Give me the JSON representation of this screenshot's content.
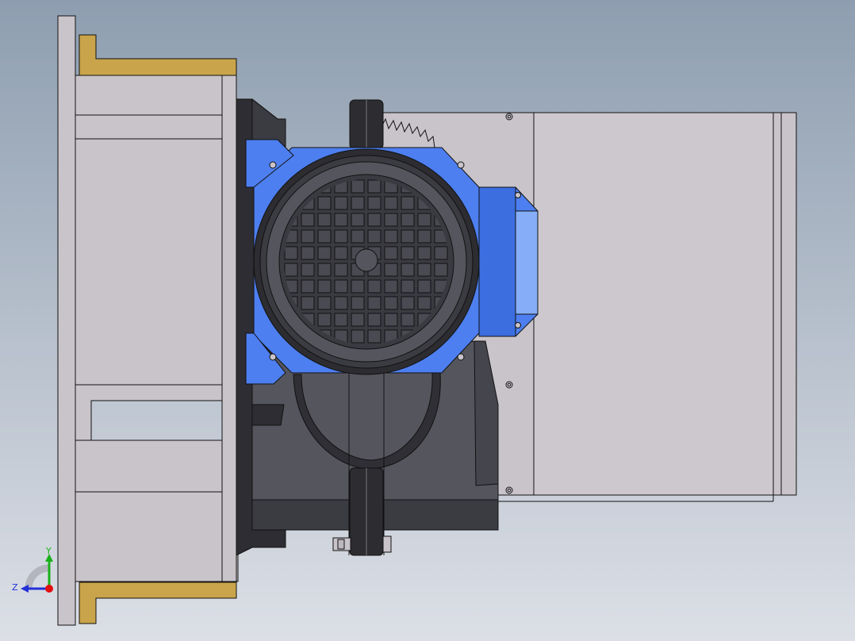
{
  "viewport": {
    "background_top": "#8e9eb0",
    "background_bottom": "#dcdfe6"
  },
  "colors": {
    "part_gray": "#c9c4ca",
    "edge": "#121212",
    "bracket_gold": "#c9a44a",
    "motor_blue": "#4d7ff0",
    "motor_blue_light": "#86aef8",
    "motor_dark": "#2c2c31",
    "gearbox_dark": "#55555e",
    "fan_grille": "#4a4a52",
    "axis_y": "#19b019",
    "axis_z": "#2230d8",
    "axis_origin": "#e01010"
  },
  "triad": {
    "y_label": "Y",
    "z_label": "Z",
    "y_icon": "axis-y-arrow-icon",
    "z_icon": "axis-z-arrow-icon",
    "rotation_icon": "view-rotation-arc-icon"
  },
  "model": {
    "fan_grid_cells": 8
  }
}
